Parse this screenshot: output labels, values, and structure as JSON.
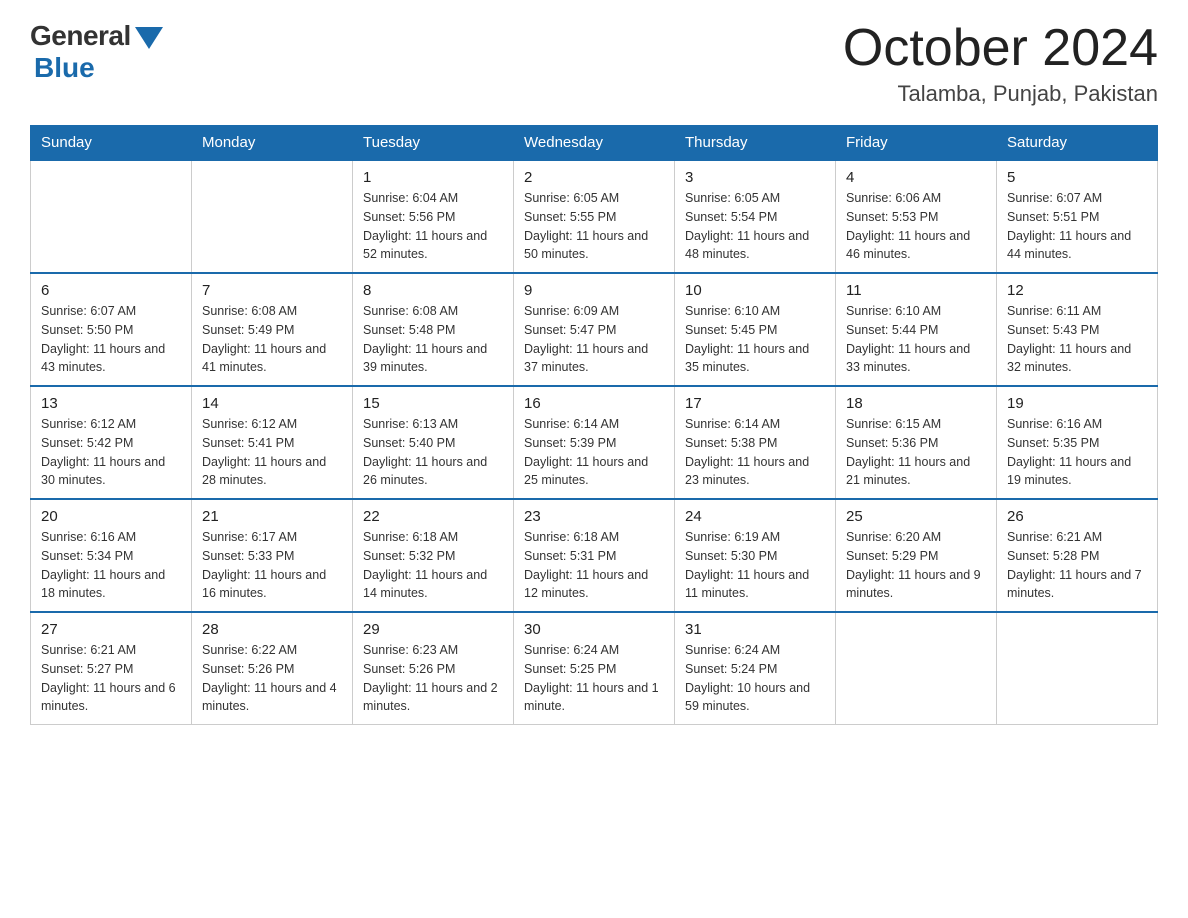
{
  "header": {
    "logo_general": "General",
    "logo_blue": "Blue",
    "month_title": "October 2024",
    "location": "Talamba, Punjab, Pakistan"
  },
  "days_of_week": [
    "Sunday",
    "Monday",
    "Tuesday",
    "Wednesday",
    "Thursday",
    "Friday",
    "Saturday"
  ],
  "weeks": [
    [
      {
        "day": "",
        "sunrise": "",
        "sunset": "",
        "daylight": ""
      },
      {
        "day": "",
        "sunrise": "",
        "sunset": "",
        "daylight": ""
      },
      {
        "day": "1",
        "sunrise": "Sunrise: 6:04 AM",
        "sunset": "Sunset: 5:56 PM",
        "daylight": "Daylight: 11 hours and 52 minutes."
      },
      {
        "day": "2",
        "sunrise": "Sunrise: 6:05 AM",
        "sunset": "Sunset: 5:55 PM",
        "daylight": "Daylight: 11 hours and 50 minutes."
      },
      {
        "day": "3",
        "sunrise": "Sunrise: 6:05 AM",
        "sunset": "Sunset: 5:54 PM",
        "daylight": "Daylight: 11 hours and 48 minutes."
      },
      {
        "day": "4",
        "sunrise": "Sunrise: 6:06 AM",
        "sunset": "Sunset: 5:53 PM",
        "daylight": "Daylight: 11 hours and 46 minutes."
      },
      {
        "day": "5",
        "sunrise": "Sunrise: 6:07 AM",
        "sunset": "Sunset: 5:51 PM",
        "daylight": "Daylight: 11 hours and 44 minutes."
      }
    ],
    [
      {
        "day": "6",
        "sunrise": "Sunrise: 6:07 AM",
        "sunset": "Sunset: 5:50 PM",
        "daylight": "Daylight: 11 hours and 43 minutes."
      },
      {
        "day": "7",
        "sunrise": "Sunrise: 6:08 AM",
        "sunset": "Sunset: 5:49 PM",
        "daylight": "Daylight: 11 hours and 41 minutes."
      },
      {
        "day": "8",
        "sunrise": "Sunrise: 6:08 AM",
        "sunset": "Sunset: 5:48 PM",
        "daylight": "Daylight: 11 hours and 39 minutes."
      },
      {
        "day": "9",
        "sunrise": "Sunrise: 6:09 AM",
        "sunset": "Sunset: 5:47 PM",
        "daylight": "Daylight: 11 hours and 37 minutes."
      },
      {
        "day": "10",
        "sunrise": "Sunrise: 6:10 AM",
        "sunset": "Sunset: 5:45 PM",
        "daylight": "Daylight: 11 hours and 35 minutes."
      },
      {
        "day": "11",
        "sunrise": "Sunrise: 6:10 AM",
        "sunset": "Sunset: 5:44 PM",
        "daylight": "Daylight: 11 hours and 33 minutes."
      },
      {
        "day": "12",
        "sunrise": "Sunrise: 6:11 AM",
        "sunset": "Sunset: 5:43 PM",
        "daylight": "Daylight: 11 hours and 32 minutes."
      }
    ],
    [
      {
        "day": "13",
        "sunrise": "Sunrise: 6:12 AM",
        "sunset": "Sunset: 5:42 PM",
        "daylight": "Daylight: 11 hours and 30 minutes."
      },
      {
        "day": "14",
        "sunrise": "Sunrise: 6:12 AM",
        "sunset": "Sunset: 5:41 PM",
        "daylight": "Daylight: 11 hours and 28 minutes."
      },
      {
        "day": "15",
        "sunrise": "Sunrise: 6:13 AM",
        "sunset": "Sunset: 5:40 PM",
        "daylight": "Daylight: 11 hours and 26 minutes."
      },
      {
        "day": "16",
        "sunrise": "Sunrise: 6:14 AM",
        "sunset": "Sunset: 5:39 PM",
        "daylight": "Daylight: 11 hours and 25 minutes."
      },
      {
        "day": "17",
        "sunrise": "Sunrise: 6:14 AM",
        "sunset": "Sunset: 5:38 PM",
        "daylight": "Daylight: 11 hours and 23 minutes."
      },
      {
        "day": "18",
        "sunrise": "Sunrise: 6:15 AM",
        "sunset": "Sunset: 5:36 PM",
        "daylight": "Daylight: 11 hours and 21 minutes."
      },
      {
        "day": "19",
        "sunrise": "Sunrise: 6:16 AM",
        "sunset": "Sunset: 5:35 PM",
        "daylight": "Daylight: 11 hours and 19 minutes."
      }
    ],
    [
      {
        "day": "20",
        "sunrise": "Sunrise: 6:16 AM",
        "sunset": "Sunset: 5:34 PM",
        "daylight": "Daylight: 11 hours and 18 minutes."
      },
      {
        "day": "21",
        "sunrise": "Sunrise: 6:17 AM",
        "sunset": "Sunset: 5:33 PM",
        "daylight": "Daylight: 11 hours and 16 minutes."
      },
      {
        "day": "22",
        "sunrise": "Sunrise: 6:18 AM",
        "sunset": "Sunset: 5:32 PM",
        "daylight": "Daylight: 11 hours and 14 minutes."
      },
      {
        "day": "23",
        "sunrise": "Sunrise: 6:18 AM",
        "sunset": "Sunset: 5:31 PM",
        "daylight": "Daylight: 11 hours and 12 minutes."
      },
      {
        "day": "24",
        "sunrise": "Sunrise: 6:19 AM",
        "sunset": "Sunset: 5:30 PM",
        "daylight": "Daylight: 11 hours and 11 minutes."
      },
      {
        "day": "25",
        "sunrise": "Sunrise: 6:20 AM",
        "sunset": "Sunset: 5:29 PM",
        "daylight": "Daylight: 11 hours and 9 minutes."
      },
      {
        "day": "26",
        "sunrise": "Sunrise: 6:21 AM",
        "sunset": "Sunset: 5:28 PM",
        "daylight": "Daylight: 11 hours and 7 minutes."
      }
    ],
    [
      {
        "day": "27",
        "sunrise": "Sunrise: 6:21 AM",
        "sunset": "Sunset: 5:27 PM",
        "daylight": "Daylight: 11 hours and 6 minutes."
      },
      {
        "day": "28",
        "sunrise": "Sunrise: 6:22 AM",
        "sunset": "Sunset: 5:26 PM",
        "daylight": "Daylight: 11 hours and 4 minutes."
      },
      {
        "day": "29",
        "sunrise": "Sunrise: 6:23 AM",
        "sunset": "Sunset: 5:26 PM",
        "daylight": "Daylight: 11 hours and 2 minutes."
      },
      {
        "day": "30",
        "sunrise": "Sunrise: 6:24 AM",
        "sunset": "Sunset: 5:25 PM",
        "daylight": "Daylight: 11 hours and 1 minute."
      },
      {
        "day": "31",
        "sunrise": "Sunrise: 6:24 AM",
        "sunset": "Sunset: 5:24 PM",
        "daylight": "Daylight: 10 hours and 59 minutes."
      },
      {
        "day": "",
        "sunrise": "",
        "sunset": "",
        "daylight": ""
      },
      {
        "day": "",
        "sunrise": "",
        "sunset": "",
        "daylight": ""
      }
    ]
  ]
}
